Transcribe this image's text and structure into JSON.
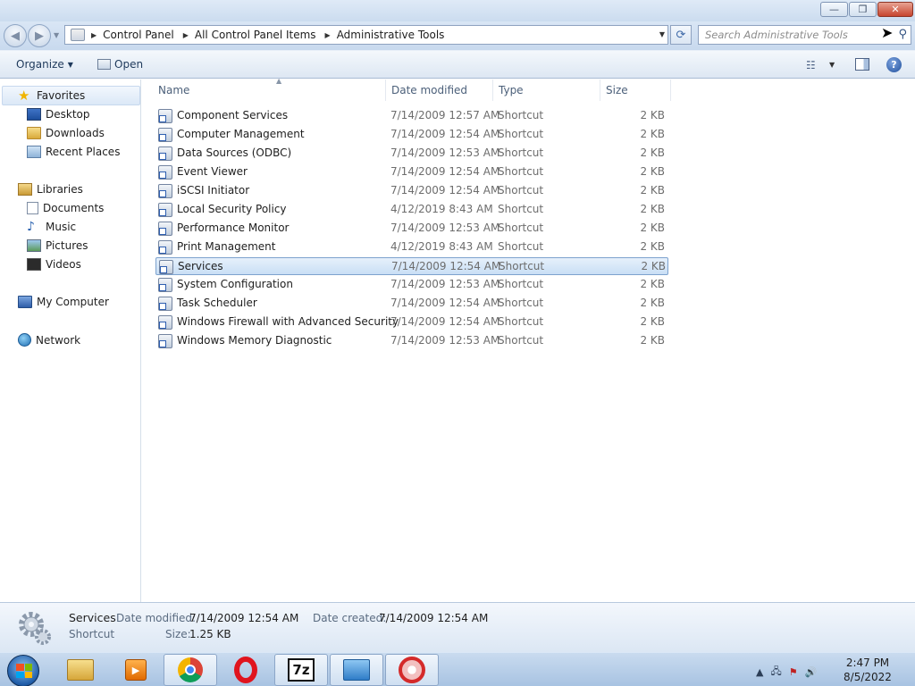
{
  "window": {
    "minimize_glyph": "—",
    "restore_glyph": "❐",
    "close_glyph": "✕"
  },
  "nav": {
    "breadcrumbs": [
      "Control Panel",
      "All Control Panel Items",
      "Administrative Tools"
    ],
    "search_placeholder": "Search Administrative Tools"
  },
  "toolbar": {
    "organize_label": "Organize",
    "open_label": "Open"
  },
  "sidebar": {
    "favorites_label": "Favorites",
    "favorites": [
      "Desktop",
      "Downloads",
      "Recent Places"
    ],
    "libraries_label": "Libraries",
    "libraries": [
      "Documents",
      "Music",
      "Pictures",
      "Videos"
    ],
    "computer_label": "My Computer",
    "network_label": "Network"
  },
  "columns": {
    "name": "Name",
    "date": "Date modified",
    "type": "Type",
    "size": "Size"
  },
  "files": [
    {
      "name": "Component Services",
      "date": "7/14/2009 12:57 AM",
      "type": "Shortcut",
      "size": "2 KB"
    },
    {
      "name": "Computer Management",
      "date": "7/14/2009 12:54 AM",
      "type": "Shortcut",
      "size": "2 KB"
    },
    {
      "name": "Data Sources (ODBC)",
      "date": "7/14/2009 12:53 AM",
      "type": "Shortcut",
      "size": "2 KB"
    },
    {
      "name": "Event Viewer",
      "date": "7/14/2009 12:54 AM",
      "type": "Shortcut",
      "size": "2 KB"
    },
    {
      "name": "iSCSI Initiator",
      "date": "7/14/2009 12:54 AM",
      "type": "Shortcut",
      "size": "2 KB"
    },
    {
      "name": "Local Security Policy",
      "date": "4/12/2019 8:43 AM",
      "type": "Shortcut",
      "size": "2 KB"
    },
    {
      "name": "Performance Monitor",
      "date": "7/14/2009 12:53 AM",
      "type": "Shortcut",
      "size": "2 KB"
    },
    {
      "name": "Print Management",
      "date": "4/12/2019 8:43 AM",
      "type": "Shortcut",
      "size": "2 KB"
    },
    {
      "name": "Services",
      "date": "7/14/2009 12:54 AM",
      "type": "Shortcut",
      "size": "2 KB"
    },
    {
      "name": "System Configuration",
      "date": "7/14/2009 12:53 AM",
      "type": "Shortcut",
      "size": "2 KB"
    },
    {
      "name": "Task Scheduler",
      "date": "7/14/2009 12:54 AM",
      "type": "Shortcut",
      "size": "2 KB"
    },
    {
      "name": "Windows Firewall with Advanced Security",
      "date": "7/14/2009 12:54 AM",
      "type": "Shortcut",
      "size": "2 KB"
    },
    {
      "name": "Windows Memory Diagnostic",
      "date": "7/14/2009 12:53 AM",
      "type": "Shortcut",
      "size": "2 KB"
    }
  ],
  "selected_file": "Services",
  "details": {
    "name": "Services",
    "type": "Shortcut",
    "date_modified_label": "Date modified:",
    "date_modified": "7/14/2009 12:54 AM",
    "date_created_label": "Date created:",
    "date_created": "7/14/2009 12:54 AM",
    "size_label": "Size:",
    "size": "1.25 KB"
  },
  "taskbar": {
    "apps": [
      "explorer-icon",
      "media-player-icon",
      "chrome-icon",
      "opera-icon",
      "7zip-icon",
      "control-panel-icon",
      "network-tool-icon"
    ],
    "sevenzip_text": "7z",
    "time": "2:47 PM",
    "date": "8/5/2022"
  },
  "colors": {
    "selection": "#c9dff5",
    "link_text": "#1e395b",
    "taskbar": "#a8c3e2"
  }
}
